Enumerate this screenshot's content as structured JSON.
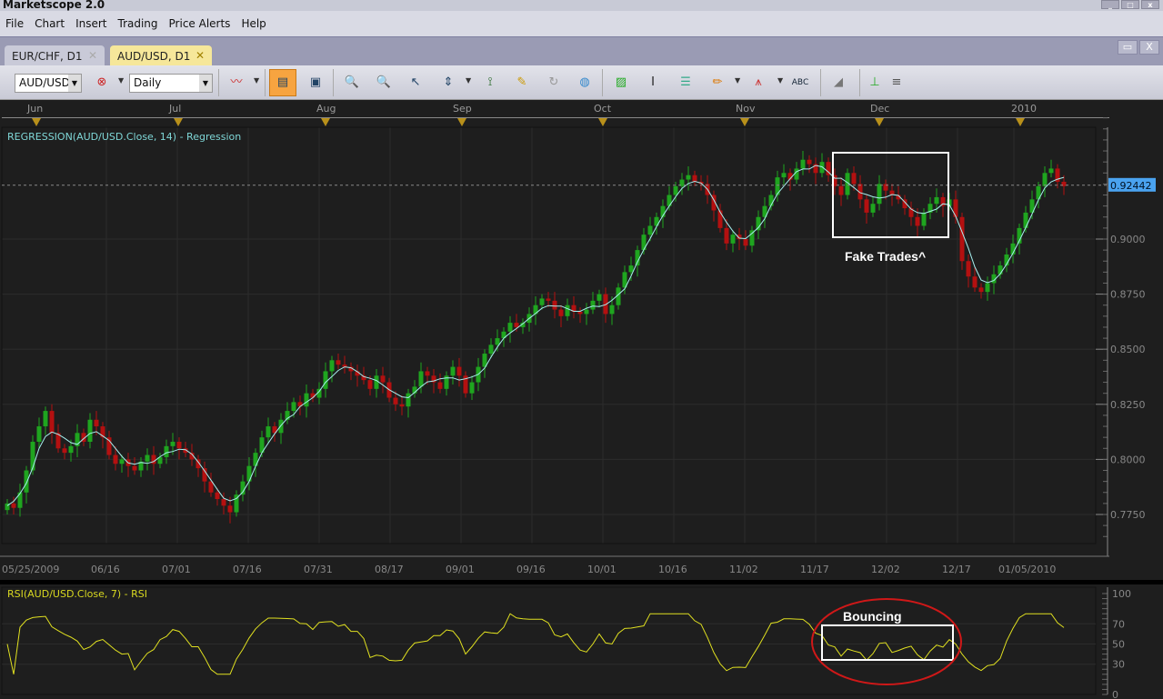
{
  "window": {
    "title": "Marketscope 2.0"
  },
  "menu": [
    "File",
    "Chart",
    "Insert",
    "Trading",
    "Price Alerts",
    "Help"
  ],
  "tabs": [
    {
      "label": "EUR/CHF, D1",
      "active": false
    },
    {
      "label": "AUD/USD, D1",
      "active": true
    }
  ],
  "toolbar": {
    "instrument": "AUD/USD",
    "timeframe": "Daily",
    "icons": [
      "chart-type-icon",
      "remove-instrument-icon",
      "bar-mode-icon",
      "text-mode-icon",
      "zoom-in-icon",
      "zoom-out-icon",
      "cursor-icon",
      "zoom-range-icon",
      "vertical-scale-icon",
      "properties-icon",
      "refresh-icon",
      "globe-icon",
      "add-image-icon",
      "text-cursor-icon",
      "template-icon",
      "pencil-icon",
      "signal-icon",
      "abc-label-icon",
      "eraser-icon",
      "hierarchy-icon",
      "more-icon"
    ]
  },
  "timeline": {
    "months": [
      "Jun",
      "Jul",
      "Aug",
      "Sep",
      "Oct",
      "Nov",
      "Dec",
      "2010"
    ]
  },
  "colors": {
    "up": "#1fa51f",
    "down": "#b41010",
    "regression": "#a8f0f0",
    "rsi": "#e0e020",
    "price_tag": "#4aa3f0",
    "annotation_ellipse": "#d01818"
  },
  "chart_data": [
    {
      "type": "candlestick",
      "title": "REGRESSION(AUD/USD.Close, 14) - Regression",
      "instrument": "AUD/USD",
      "period": 14,
      "ylim": [
        0.7625,
        0.96
      ],
      "yticks": [
        "0.9000",
        "0.8750",
        "0.8500",
        "0.8250",
        "0.8000",
        "0.7750"
      ],
      "xticks": [
        "05/25/2009",
        "06/16",
        "07/01",
        "07/16",
        "07/31",
        "08/17",
        "09/01",
        "09/16",
        "10/01",
        "10/16",
        "11/02",
        "11/17",
        "12/02",
        "12/17",
        "01/05/2010"
      ],
      "last_price": "0.92442",
      "closes": [
        0.78,
        0.778,
        0.785,
        0.795,
        0.808,
        0.815,
        0.822,
        0.812,
        0.805,
        0.803,
        0.806,
        0.812,
        0.808,
        0.818,
        0.815,
        0.81,
        0.802,
        0.798,
        0.8,
        0.797,
        0.795,
        0.799,
        0.802,
        0.798,
        0.801,
        0.806,
        0.808,
        0.805,
        0.803,
        0.8,
        0.796,
        0.79,
        0.785,
        0.782,
        0.779,
        0.776,
        0.784,
        0.79,
        0.797,
        0.803,
        0.81,
        0.815,
        0.812,
        0.818,
        0.822,
        0.826,
        0.824,
        0.83,
        0.828,
        0.832,
        0.84,
        0.845,
        0.843,
        0.842,
        0.84,
        0.838,
        0.836,
        0.832,
        0.838,
        0.835,
        0.828,
        0.825,
        0.824,
        0.83,
        0.833,
        0.84,
        0.838,
        0.835,
        0.832,
        0.838,
        0.842,
        0.838,
        0.83,
        0.835,
        0.842,
        0.848,
        0.852,
        0.855,
        0.858,
        0.862,
        0.86,
        0.862,
        0.866,
        0.87,
        0.873,
        0.872,
        0.868,
        0.865,
        0.87,
        0.867,
        0.866,
        0.868,
        0.872,
        0.875,
        0.866,
        0.87,
        0.878,
        0.885,
        0.888,
        0.895,
        0.902,
        0.906,
        0.91,
        0.915,
        0.92,
        0.924,
        0.927,
        0.929,
        0.926,
        0.925,
        0.92,
        0.913,
        0.905,
        0.898,
        0.902,
        0.9,
        0.897,
        0.904,
        0.91,
        0.915,
        0.92,
        0.928,
        0.93,
        0.927,
        0.932,
        0.936,
        0.934,
        0.93,
        0.935,
        0.929,
        0.924,
        0.92,
        0.93,
        0.925,
        0.918,
        0.912,
        0.916,
        0.925,
        0.922,
        0.92,
        0.918,
        0.914,
        0.91,
        0.906,
        0.912,
        0.916,
        0.919,
        0.915,
        0.918,
        0.91,
        0.89,
        0.883,
        0.878,
        0.876,
        0.88,
        0.884,
        0.888,
        0.893,
        0.898,
        0.905,
        0.912,
        0.918,
        0.924,
        0.93,
        0.932,
        0.926,
        0.924
      ],
      "annotation": "Fake Trades^"
    },
    {
      "type": "line",
      "title": "RSI(AUD/USD.Close, 7) - RSI",
      "period": 7,
      "ylim": [
        0,
        100
      ],
      "yticks": [
        "100",
        "70",
        "50",
        "30",
        "0"
      ],
      "annotation": "Bouncing"
    }
  ]
}
